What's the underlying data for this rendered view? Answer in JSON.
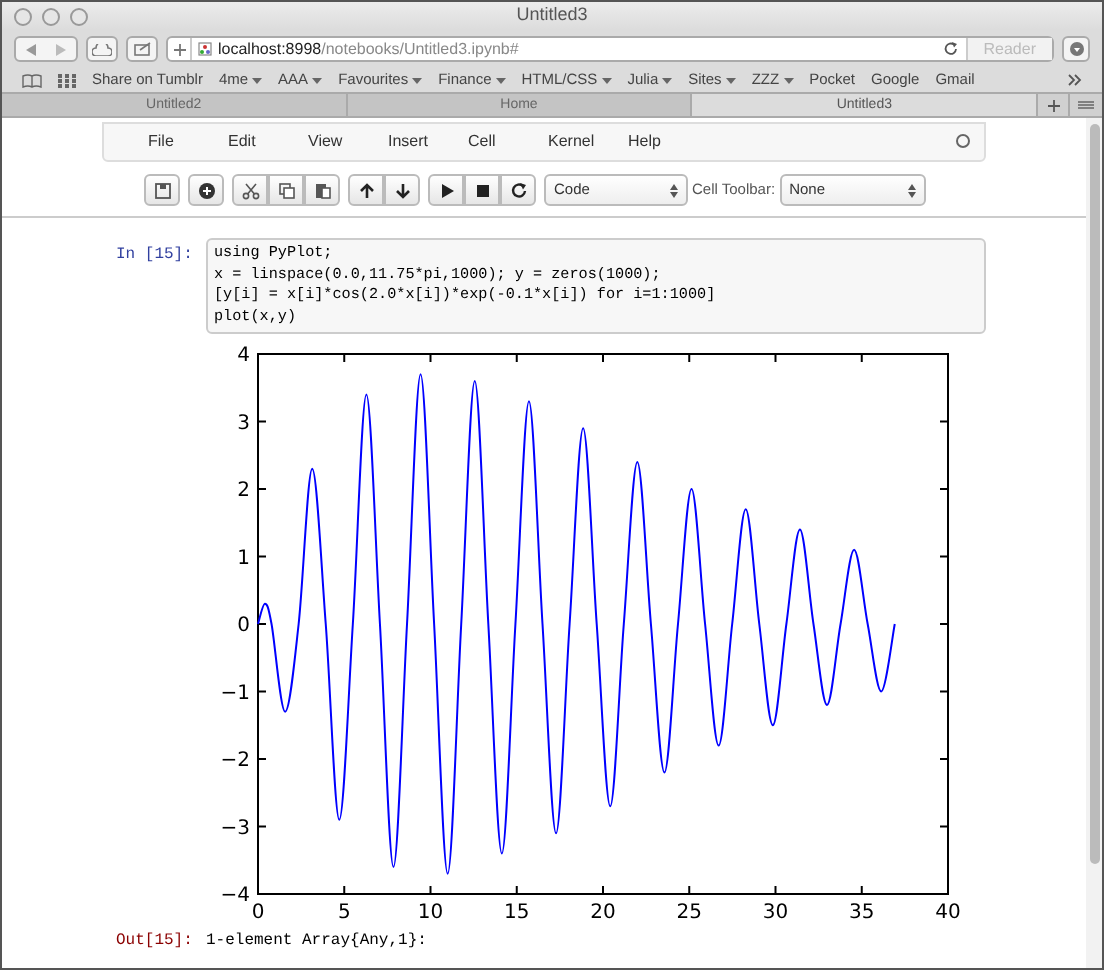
{
  "window": {
    "title": "Untitled3"
  },
  "address_bar": {
    "host": "localhost:8998",
    "path": "/notebooks/Untitled3.ipynb#",
    "reader": "Reader"
  },
  "bookmarks": [
    "Share on Tumblr",
    {
      "label": "4me",
      "menu": true
    },
    {
      "label": "AAA",
      "menu": true
    },
    {
      "label": "Favourites",
      "menu": true
    },
    {
      "label": "Finance",
      "menu": true
    },
    {
      "label": "HTML/CSS",
      "menu": true
    },
    {
      "label": "Julia",
      "menu": true
    },
    {
      "label": "Sites",
      "menu": true
    },
    {
      "label": "ZZZ",
      "menu": true
    },
    "Pocket",
    "Google",
    "Gmail"
  ],
  "tabs": [
    {
      "label": "Untitled2",
      "selected": false
    },
    {
      "label": "Home",
      "selected": false
    },
    {
      "label": "Untitled3",
      "selected": true
    }
  ],
  "menu": [
    "File",
    "Edit",
    "View",
    "Insert",
    "Cell",
    "Kernel",
    "Help"
  ],
  "toolbar": {
    "cell_type": "Code",
    "cell_toolbar_label": "Cell Toolbar:",
    "cell_toolbar": "None"
  },
  "cell": {
    "prompt": "In [15]:",
    "code": [
      "using PyPlot;",
      "x = linspace(0.0,11.75*pi,1000); y = zeros(1000);",
      "[y[i] = x[i]*cos(2.0*x[i])*exp(-0.1*x[i]) for i=1:1000]",
      "plot(x,y)"
    ],
    "chart_data": {
      "type": "line",
      "xlim": [
        0,
        40
      ],
      "ylim": [
        -4,
        4
      ],
      "xticks": [
        0,
        5,
        10,
        15,
        20,
        25,
        30,
        35,
        40
      ],
      "yticks": [
        -4,
        -3,
        -2,
        -1,
        0,
        1,
        2,
        3,
        4
      ],
      "x": [
        0,
        0.4,
        0.785,
        1.571,
        2.356,
        3.142,
        3.927,
        4.712,
        5.498,
        6.283,
        7.069,
        7.854,
        8.639,
        9.425,
        10.21,
        10.996,
        11.781,
        12.566,
        13.352,
        14.137,
        14.923,
        15.708,
        16.493,
        17.279,
        18.064,
        18.85,
        19.635,
        20.42,
        21.206,
        21.991,
        22.777,
        23.562,
        24.347,
        25.133,
        25.918,
        26.704,
        27.489,
        28.274,
        29.06,
        29.845,
        30.631,
        31.416,
        32.201,
        32.987,
        33.772,
        34.558,
        35.343,
        36.128,
        36.914
      ],
      "series": [
        {
          "color": "#0000ff",
          "values": [
            0,
            0.3,
            0,
            -1.3,
            0,
            2.3,
            0,
            -2.9,
            0,
            3.4,
            0,
            -3.6,
            0,
            3.7,
            0,
            -3.7,
            0,
            3.6,
            0,
            -3.4,
            0,
            3.3,
            0,
            -3.1,
            0,
            2.9,
            0,
            -2.7,
            0,
            2.4,
            0,
            -2.2,
            0,
            2.0,
            0,
            -1.8,
            0,
            1.7,
            0,
            -1.5,
            0,
            1.4,
            0,
            -1.2,
            0,
            1.1,
            0,
            -1.0,
            0
          ]
        }
      ]
    }
  },
  "output": {
    "prompt": "Out[15]:",
    "text": "1-element Array{Any,1}:"
  }
}
